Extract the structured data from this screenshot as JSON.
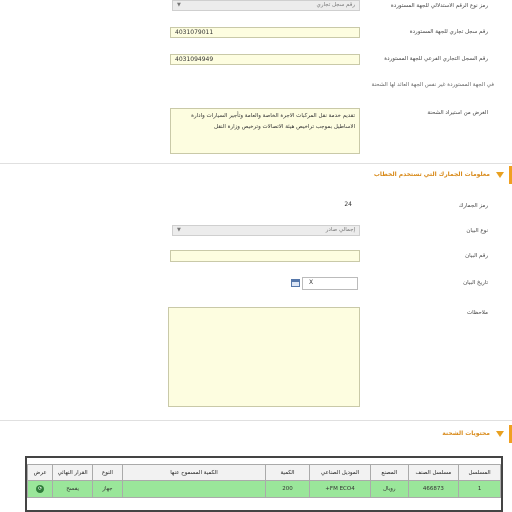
{
  "form": {
    "reg_type": {
      "label": "رمز نوع الرقم الاستدلالي للجهة المستوردة",
      "value": "رقم سجل تجاري"
    },
    "cr_number": {
      "label": "رقم سجل تجاري للجهة المستوردة",
      "value": "4031079011"
    },
    "cr_number2": {
      "label": "رقم السجل التجاري الفرعي للجهة المستوردة",
      "value": "4031094949"
    },
    "note_text": "في الجهة المستوردة غير نفس الجهة العائد لها الشحنة",
    "purpose": {
      "label": "الغرض من استيراد الشحنة",
      "value": "تقديم خدمة نقل المركبات الاجرة الخاصة والعامة وتأجير السيارات وادارة الاساطيل بموجب تراخيص هيئة الاتصالات وترخيص وزارة النقل"
    }
  },
  "section_letter": {
    "title": "معلومات الجمارك التي تستخدم الخطاب",
    "customs_code": {
      "label": "رمز الجمارك",
      "value": "24"
    },
    "statement_type": {
      "label": "نوع البيان",
      "value": "إجمالي صادر"
    },
    "statement_number": {
      "label": "رقم البيان",
      "value": ""
    },
    "statement_date": {
      "label": "تاريخ البيان",
      "value": "X"
    },
    "notes": {
      "label": "ملاحظات",
      "value": ""
    }
  },
  "section_shipment": {
    "title": "محتويات الشحنة",
    "columns": [
      "المسلسل",
      "مسلسل الصنف",
      "المصنع",
      "الموديل الصناعي",
      "الكمية",
      "الكمية المسموح عنها",
      "النوع",
      "القرار النهائي",
      "عرض"
    ],
    "rows": [
      [
        "1",
        "466873",
        "رويال",
        "FM ECO4+",
        "200",
        "",
        "جهاز",
        "يفسح",
        ""
      ]
    ]
  },
  "colors": {
    "accent": "#e8a020",
    "row_bg": "#9ae69a",
    "field_bg": "#fdfde0"
  },
  "icons": [
    "calendar-icon",
    "view-icon",
    "chevron-down-icon"
  ]
}
